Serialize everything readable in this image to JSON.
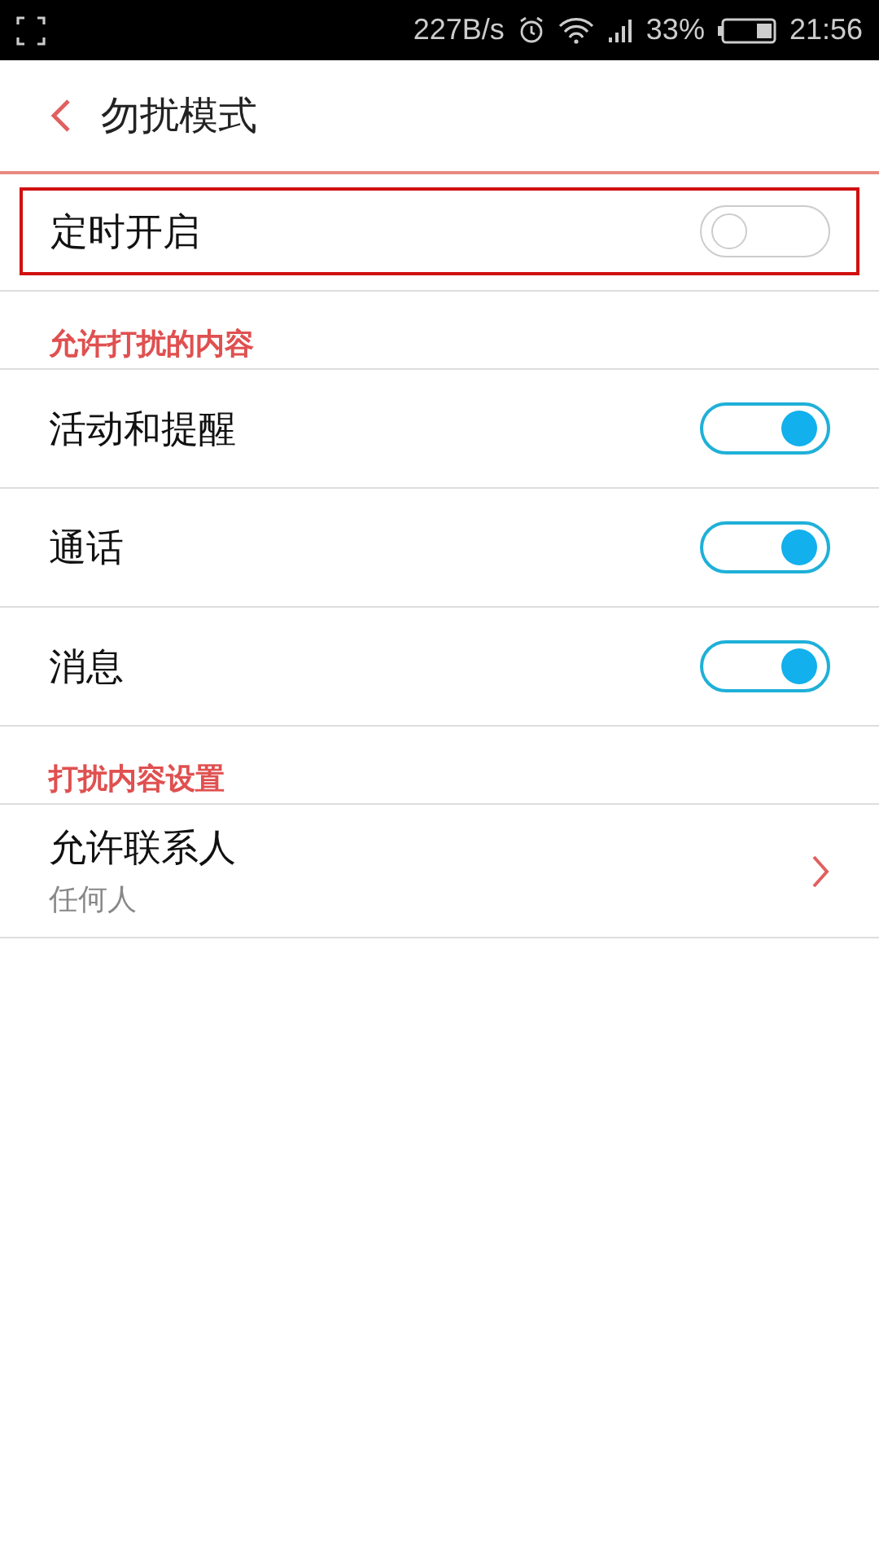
{
  "status_bar": {
    "network_speed": "227B/s",
    "battery_percent": "33%",
    "time": "21:56"
  },
  "header": {
    "title": "勿扰模式"
  },
  "schedule": {
    "label": "定时开启",
    "on": false,
    "highlighted": true
  },
  "sections": [
    {
      "title": "允许打扰的内容",
      "items": [
        {
          "kind": "toggle",
          "label": "活动和提醒",
          "on": true
        },
        {
          "kind": "toggle",
          "label": "通话",
          "on": true
        },
        {
          "kind": "toggle",
          "label": "消息",
          "on": true
        }
      ]
    },
    {
      "title": "打扰内容设置",
      "items": [
        {
          "kind": "link",
          "label": "允许联系人",
          "value": "任何人"
        }
      ]
    }
  ]
}
